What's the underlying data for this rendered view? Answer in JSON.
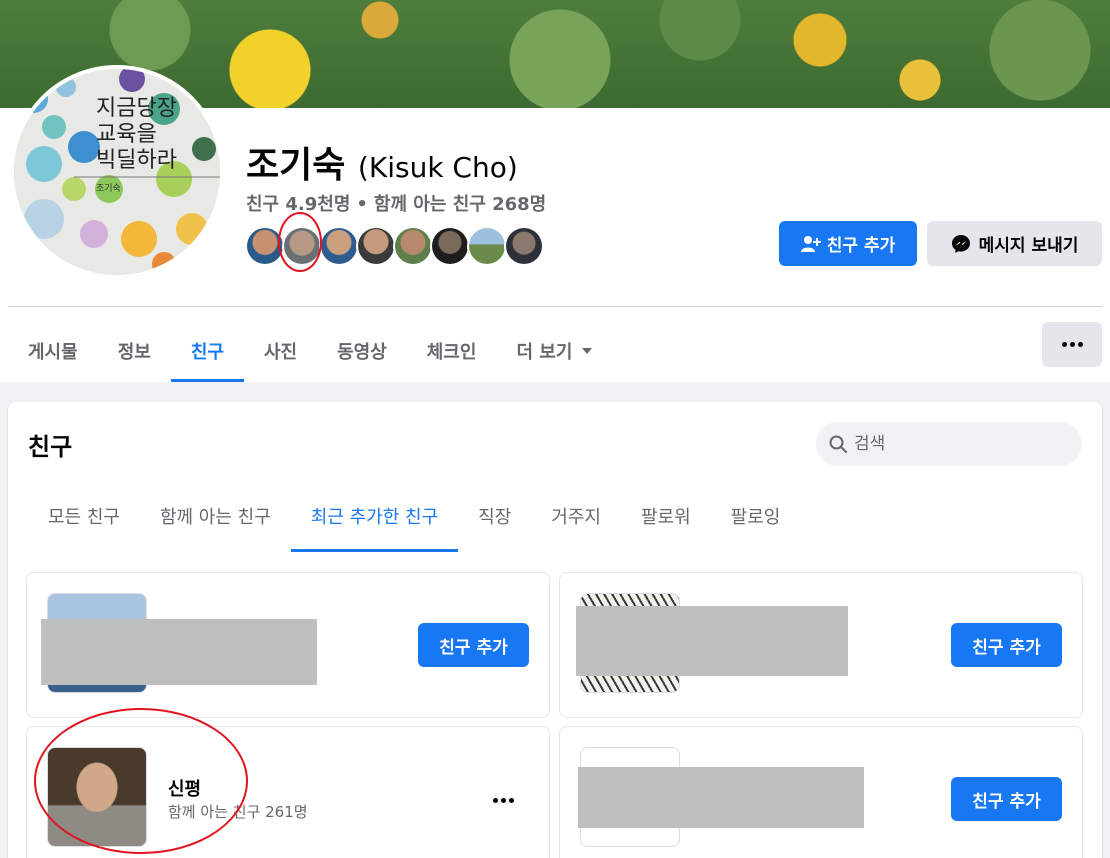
{
  "profile": {
    "name": "조기숙",
    "latin_name": "(Kisuk Cho)",
    "friends_count": "친구 4.9천명",
    "separator": "•",
    "mutual_count": "함께 아는 친구 268명",
    "avatar_text": {
      "line1": "지금당장",
      "line2": "교육을",
      "line3": "빅딜하라",
      "author": "조기숙"
    },
    "add_friend_label": "친구 추가",
    "message_label": "메시지 보내기"
  },
  "nav": {
    "tabs": [
      {
        "label": "게시물"
      },
      {
        "label": "정보"
      },
      {
        "label": "친구"
      },
      {
        "label": "사진"
      },
      {
        "label": "동영상"
      },
      {
        "label": "체크인"
      },
      {
        "label": "더 보기"
      }
    ],
    "active_index": 2
  },
  "friends": {
    "title": "친구",
    "search_placeholder": "검색",
    "subtabs": [
      {
        "label": "모든 친구"
      },
      {
        "label": "함께 아는 친구"
      },
      {
        "label": "최근 추가한 친구"
      },
      {
        "label": "직장"
      },
      {
        "label": "거주지"
      },
      {
        "label": "팔로워"
      },
      {
        "label": "팔로잉"
      }
    ],
    "active_subtab": 2,
    "cards": [
      {
        "add_label": "친구 추가"
      },
      {
        "add_label": "친구 추가"
      },
      {
        "name": "신평",
        "mutual": "함께 아는 친구 261명"
      },
      {
        "add_label": "친구 추가"
      }
    ]
  },
  "colors": {
    "accent": "#1877f2",
    "secondary_button": "#e4e6eb",
    "muted_text": "#65676b",
    "annotation": "#e0141e"
  }
}
